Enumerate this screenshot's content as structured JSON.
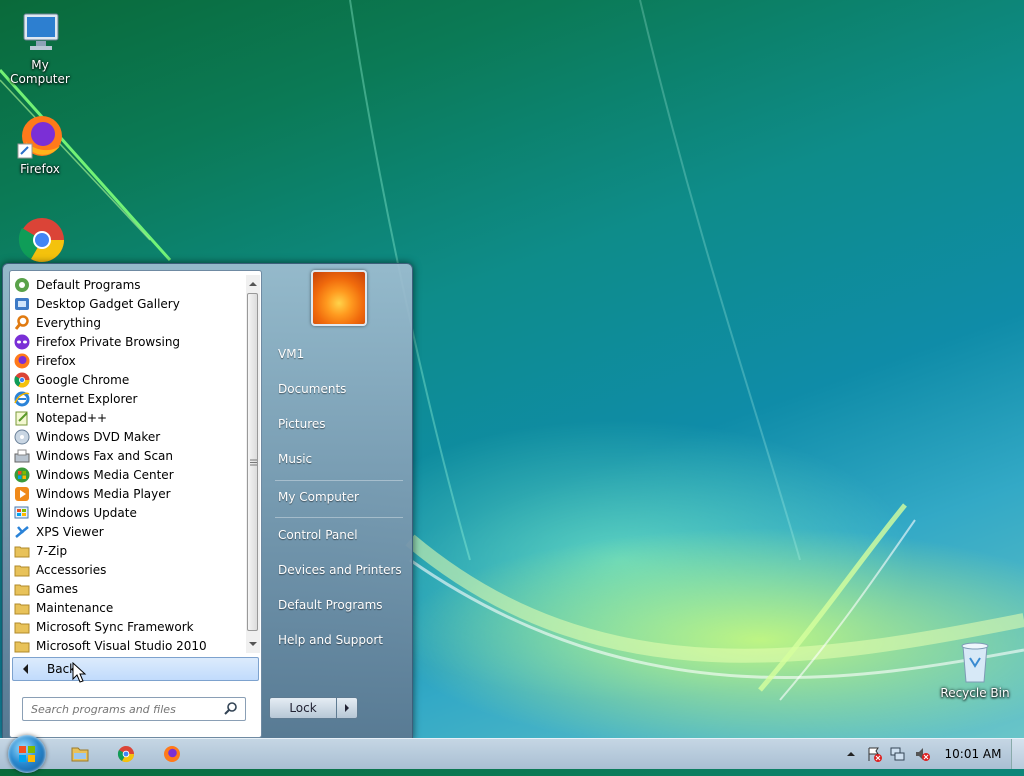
{
  "desktop": {
    "icons": [
      {
        "label": "My Computer",
        "icon": "computer-icon"
      },
      {
        "label": "Firefox",
        "icon": "firefox-icon"
      },
      {
        "label": "",
        "icon": "chrome-icon"
      },
      {
        "label": "Recycle Bin",
        "icon": "recycle-bin-icon"
      }
    ]
  },
  "start_menu": {
    "programs": [
      {
        "label": "Default Programs",
        "icon": "default-programs-icon"
      },
      {
        "label": "Desktop Gadget Gallery",
        "icon": "gadget-icon"
      },
      {
        "label": "Everything",
        "icon": "everything-search-icon"
      },
      {
        "label": "Firefox Private Browsing",
        "icon": "firefox-private-icon"
      },
      {
        "label": "Firefox",
        "icon": "firefox-icon"
      },
      {
        "label": "Google Chrome",
        "icon": "chrome-icon"
      },
      {
        "label": "Internet Explorer",
        "icon": "internet-explorer-icon"
      },
      {
        "label": "Notepad++",
        "icon": "notepad-plus-icon"
      },
      {
        "label": "Windows DVD Maker",
        "icon": "dvd-maker-icon"
      },
      {
        "label": "Windows Fax and Scan",
        "icon": "fax-scan-icon"
      },
      {
        "label": "Windows Media Center",
        "icon": "media-center-icon"
      },
      {
        "label": "Windows Media Player",
        "icon": "media-player-icon"
      },
      {
        "label": "Windows Update",
        "icon": "windows-update-icon"
      },
      {
        "label": "XPS Viewer",
        "icon": "xps-viewer-icon"
      },
      {
        "label": "7-Zip",
        "icon": "folder-icon"
      },
      {
        "label": "Accessories",
        "icon": "folder-icon"
      },
      {
        "label": "Games",
        "icon": "folder-icon"
      },
      {
        "label": "Maintenance",
        "icon": "folder-icon"
      },
      {
        "label": "Microsoft Sync Framework",
        "icon": "folder-icon"
      },
      {
        "label": "Microsoft Visual Studio 2010",
        "icon": "folder-icon"
      }
    ],
    "back_label": "Back",
    "search_placeholder": "Search programs and files",
    "right_items": [
      "VM1",
      "Documents",
      "Pictures",
      "Music",
      "My Computer",
      "Control Panel",
      "Devices and Printers",
      "Default Programs",
      "Help and Support"
    ],
    "lock_label": "Lock"
  },
  "taskbar": {
    "pinned": [
      "file-explorer-icon",
      "chrome-icon",
      "firefox-icon"
    ],
    "tray_icons": [
      "show-hidden-icons-chevron",
      "action-center-flag-icon",
      "network-icon",
      "volume-muted-icon"
    ],
    "clock": "10:01 AM"
  },
  "colors": {
    "taskbar": "#b7cadb",
    "menu_left_bg": "#ffffff",
    "back_highlight": "#c8ddfb",
    "wallpaper_accent": "#0e8c8a"
  }
}
